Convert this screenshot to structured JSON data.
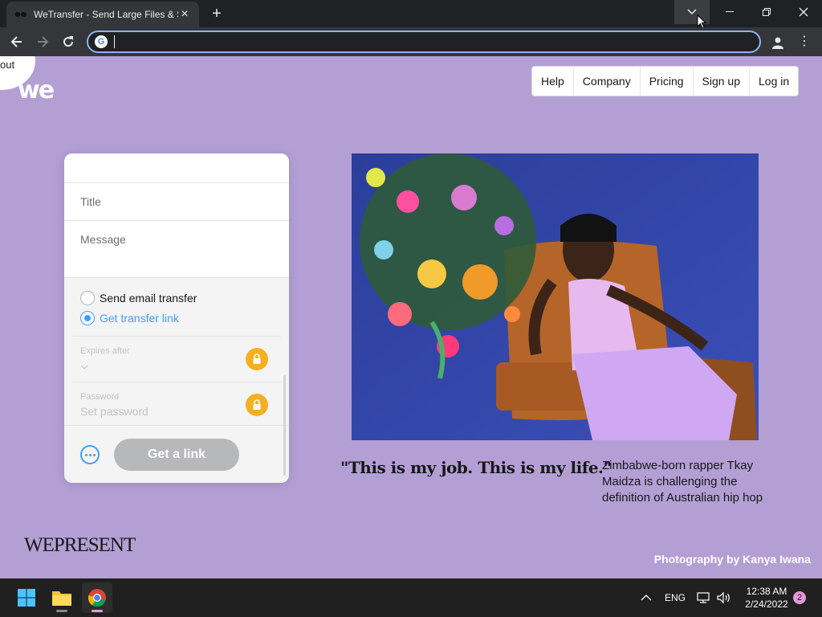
{
  "browser": {
    "tab_title": "WeTransfer - Send Large Files & Sh",
    "url_value": "",
    "colors": {
      "frame": "#202124",
      "toolbar": "#35363a",
      "focus_ring": "#8ab4f8"
    }
  },
  "page": {
    "about_label": "out",
    "logo": "we",
    "nav": [
      "Help",
      "Company",
      "Pricing",
      "Sign up",
      "Log in"
    ],
    "transfer": {
      "title_placeholder": "Title",
      "message_placeholder": "Message",
      "radio_email": "Send email transfer",
      "radio_link": "Get transfer link",
      "selected": "Get transfer link",
      "expires_label": "Expires after",
      "password_label": "Password",
      "password_placeholder": "Set password",
      "button_label": "Get a link"
    },
    "feature": {
      "quote": "\"This is my job. This is my life.\"",
      "blurb": "Zimbabwe-born rapper Tkay Maidza is challenging the definition of Australian hip hop",
      "brand": "WEPRESENT",
      "credit": "Photography by Kanya Iwana"
    },
    "colors": {
      "background": "#b39fd4",
      "accent": "#409fff",
      "lock": "#f4b021"
    }
  },
  "taskbar": {
    "language": "ENG",
    "time": "12:38 AM",
    "date": "2/24/2022",
    "notifications": "2"
  }
}
